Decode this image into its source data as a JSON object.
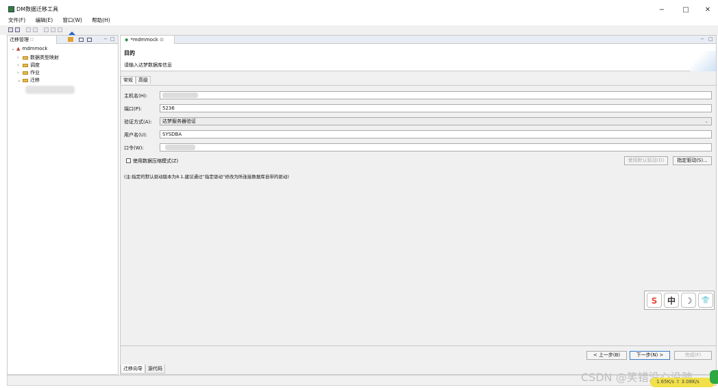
{
  "window": {
    "title": "DM数据迁移工具",
    "controls": {
      "minimize": "−",
      "maximize": "□",
      "close": "✕"
    }
  },
  "menubar": [
    "文件(F)",
    "编辑(E)",
    "窗口(W)",
    "帮助(H)"
  ],
  "left": {
    "tab_label": "迁移管理 ∷",
    "root": "mdmmock",
    "items": [
      "数据类型映射",
      "调度",
      "作业",
      "迁移"
    ]
  },
  "right": {
    "tab_label": "*mdmmock",
    "header": {
      "title": "目的",
      "desc": "请输入达梦数据库信息"
    },
    "subtabs": [
      "常规",
      "高级"
    ],
    "form": {
      "host_label": "主机名(H):",
      "port_label": "端口(P):",
      "port_value": "5236",
      "auth_label": "验证方式(A):",
      "auth_value": "达梦服务器验证",
      "user_label": "用户名(U):",
      "user_value": "SYSDBA",
      "pwd_label": "口令(W):",
      "compress_label": "使用数据压缩模式(Z)",
      "default_driver_btn": "使用默认驱动(D)",
      "specify_driver_btn": "指定驱动(S)...",
      "note": "(注:指定的默认驱动版本为8.1,建议通过“指定驱动”修改为所连接数据库自带的驱动)"
    },
    "wizard": {
      "prev": "< 上一步(B)",
      "next": "下一步(N) >",
      "finish": "完成(F)"
    },
    "bottom_tabs": [
      "迁移向导",
      "源代码"
    ]
  },
  "ime": [
    "S",
    "中",
    "☽",
    "👕"
  ],
  "status": {
    "text": "1.65K/s  ⇧ 3.08K/s"
  },
  "watermark": "CSDN @笑错没心没肺"
}
